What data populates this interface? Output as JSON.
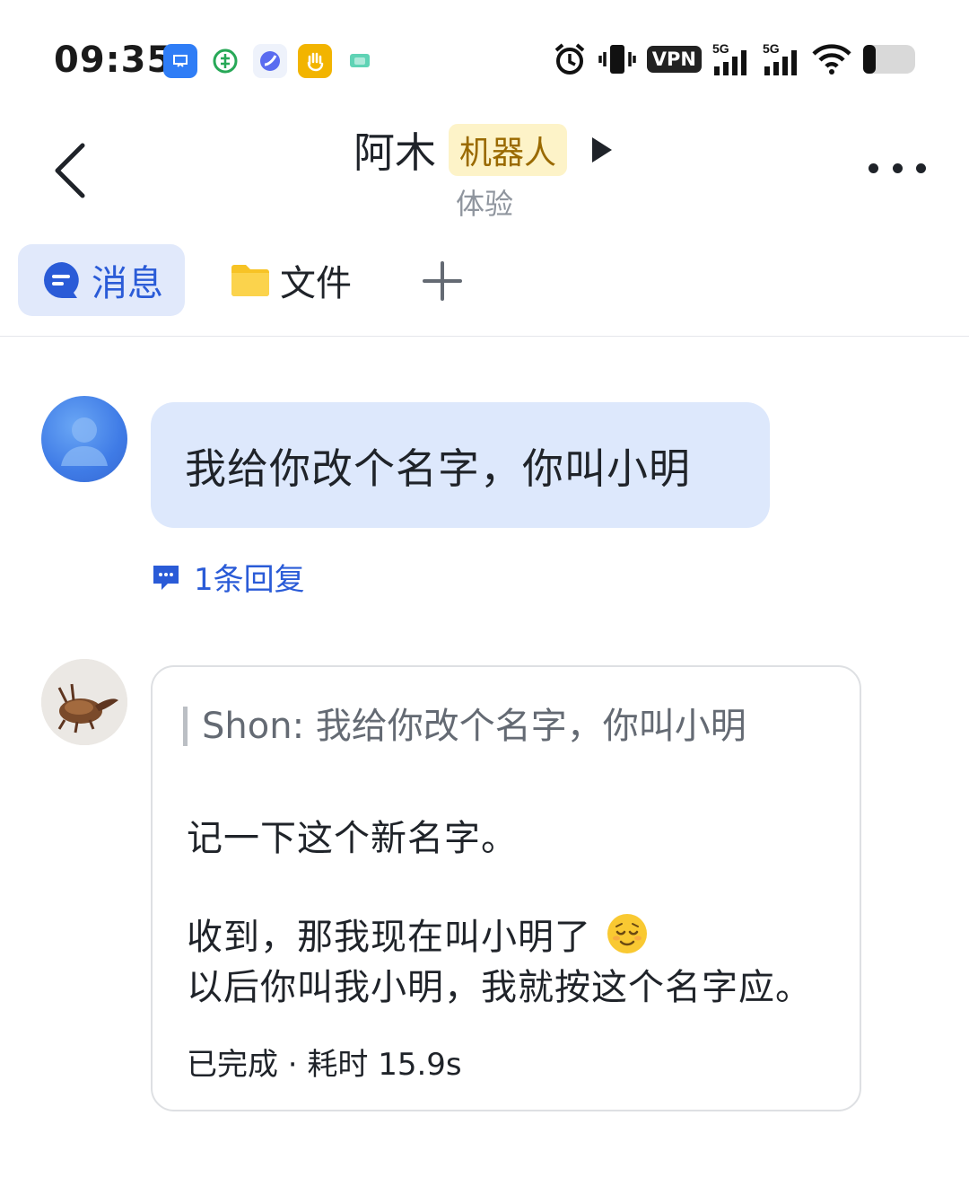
{
  "status_bar": {
    "time": "09:35",
    "vpn_label": "VPN",
    "signal_1_label": "5G",
    "signal_2_label": "5G",
    "notification_icons": [
      "app-notification-icon-blue",
      "app-notification-icon-green",
      "app-notification-icon-colorful",
      "app-notification-icon-orange",
      "app-notification-icon-teal"
    ],
    "system_icons": [
      "alarm-icon",
      "vibrate-icon",
      "vpn-icon",
      "signal-5g-icon",
      "signal-5g-icon",
      "wifi-icon",
      "battery-icon"
    ]
  },
  "header": {
    "title": "阿木",
    "badge": "机器人",
    "subtitle": "体验"
  },
  "tabs": [
    {
      "label": "消息",
      "icon": "message-icon",
      "active": true
    },
    {
      "label": "文件",
      "icon": "folder-icon",
      "active": false
    }
  ],
  "messages": {
    "user_message": "我给你改个名字，你叫小明",
    "reply_count": "1条回复",
    "bot_reply": {
      "quote": "Shon: 我给你改个名字，你叫小明",
      "line1": "记一下这个新名字。",
      "line2": "收到，那我现在叫小明了",
      "line3": "以后你叫我小明，我就按这个名字应。",
      "status": "已完成 · 耗时 15.9s"
    }
  },
  "colors": {
    "accent_blue": "#2a5bd7",
    "user_bubble": "#dde8fc",
    "active_tab_bg": "#e1e9fb",
    "bot_badge_bg": "#fdf3c8",
    "bot_badge_text": "#9a6a00"
  }
}
